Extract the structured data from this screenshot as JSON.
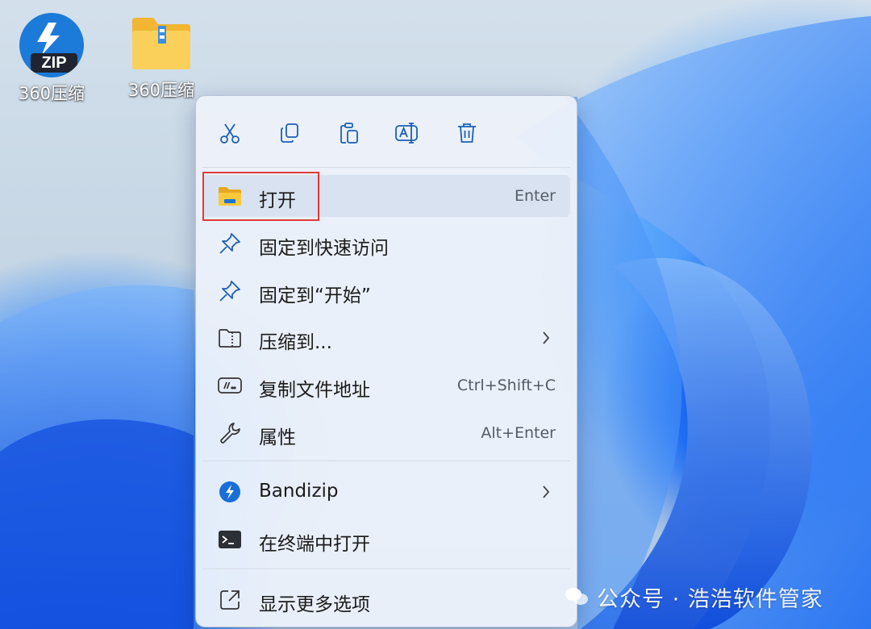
{
  "desktop": {
    "icons": [
      {
        "label": "360压缩",
        "icon": "zip-app-icon"
      },
      {
        "label": "360压缩",
        "icon": "folder-icon"
      }
    ]
  },
  "context_menu": {
    "toolbar": [
      {
        "name": "cut",
        "icon": "scissors-icon"
      },
      {
        "name": "copy",
        "icon": "copy-icon"
      },
      {
        "name": "paste",
        "icon": "paste-icon"
      },
      {
        "name": "rename",
        "icon": "rename-icon"
      },
      {
        "name": "delete",
        "icon": "trash-icon"
      }
    ],
    "items": [
      {
        "label": "打开",
        "shortcut": "Enter",
        "icon": "folder-icon"
      },
      {
        "label": "固定到快速访问",
        "shortcut": "",
        "icon": "pin-icon"
      },
      {
        "label": "固定到“开始”",
        "shortcut": "",
        "icon": "pin-icon"
      },
      {
        "label": "压缩到...",
        "shortcut": "",
        "icon": "zip-folder-icon",
        "submenu": true
      },
      {
        "label": "复制文件地址",
        "shortcut": "Ctrl+Shift+C",
        "icon": "path-icon"
      },
      {
        "label": "属性",
        "shortcut": "Alt+Enter",
        "icon": "wrench-icon"
      },
      {
        "label": "Bandizip",
        "shortcut": "",
        "icon": "bandizip-icon",
        "submenu": true
      },
      {
        "label": "在终端中打开",
        "shortcut": "",
        "icon": "terminal-icon"
      },
      {
        "label": "显示更多选项",
        "shortcut": "",
        "icon": "external-link-icon"
      }
    ]
  },
  "watermark": {
    "text": "公众号 · 浩浩软件管家"
  },
  "colors": {
    "accent": "#0067c0",
    "highlight_border": "#e23a3a",
    "folder_yellow": "#f7c440"
  }
}
